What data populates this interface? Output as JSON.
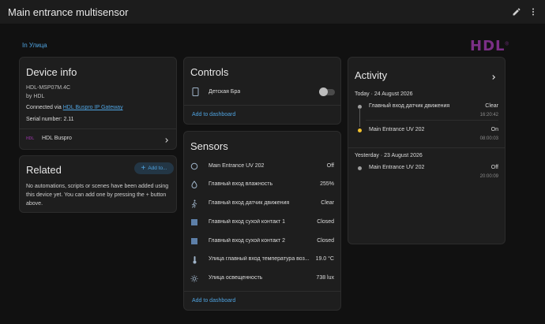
{
  "header": {
    "title": "Main entrance multisensor"
  },
  "area": {
    "label": "In Улица"
  },
  "logo": {
    "text": "HDL",
    "reg": "®",
    "color": "#7b2f86"
  },
  "device_info": {
    "title": "Device info",
    "model": "HDL-MSP07M.4C",
    "manufacturer": "by HDL",
    "connected_prefix": "Connected via ",
    "connected_link": "HDL Buspro IP Gateway",
    "serial": "Serial number: 2.11",
    "integration_logo": "HDL",
    "integration_name": "HDL Buspro"
  },
  "related": {
    "title": "Related",
    "add_label": "Add to...",
    "empty_text": "No automations, scripts or scenes have been added using this device yet. You can add one by pressing the + button above."
  },
  "controls": {
    "title": "Controls",
    "items": [
      {
        "label": "Детская Бра",
        "icon": "tablet-icon",
        "state": "off"
      }
    ],
    "add_dashboard": "Add to dashboard"
  },
  "sensors": {
    "title": "Sensors",
    "items": [
      {
        "label": "Main Entrance UV 202",
        "value": "Off",
        "icon": "circle-icon"
      },
      {
        "label": "Главный вход влажность",
        "value": "255%",
        "icon": "water-drop-icon"
      },
      {
        "label": "Главный вход датчик движения",
        "value": "Clear",
        "icon": "walk-icon"
      },
      {
        "label": "Главный вход сухой контакт 1",
        "value": "Closed",
        "icon": "square-icon"
      },
      {
        "label": "Главный вход сухой контакт 2",
        "value": "Closed",
        "icon": "square-icon"
      },
      {
        "label": "Улица главный вход температура воз...",
        "value": "19.0 °C",
        "icon": "thermometer-icon"
      },
      {
        "label": "Улица освещенность",
        "value": "738 lux",
        "icon": "brightness-icon"
      }
    ],
    "add_dashboard": "Add to dashboard"
  },
  "activity": {
    "title": "Activity",
    "groups": [
      {
        "date": "Today · 24 August 2026",
        "events": [
          {
            "name": "Главный вход датчик движения",
            "state": "Clear",
            "time": "16:20:42",
            "dot_color": "#9e9e9e"
          },
          {
            "name": "Main Entrance UV 202",
            "state": "On",
            "time": "08:00:03",
            "dot_color": "#f2c12e"
          }
        ]
      },
      {
        "date": "Yesterday · 23 August 2026",
        "events": [
          {
            "name": "Main Entrance UV 202",
            "state": "Off",
            "time": "20:00:09",
            "dot_color": "#9e9e9e"
          }
        ]
      }
    ]
  },
  "colors": {
    "accent": "#4fa3e0",
    "card": "#1e1e1e",
    "background": "#111111",
    "sensor_icon": "#5d7fa8"
  }
}
